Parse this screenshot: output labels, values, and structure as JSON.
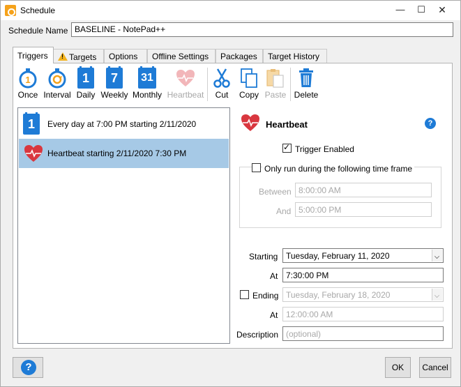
{
  "window": {
    "title": "Schedule",
    "minimize": "—",
    "maximize": "☐",
    "close": "✕"
  },
  "schedule_name": {
    "label": "Schedule Name",
    "value": "BASELINE - NotePad++"
  },
  "tabs": [
    {
      "label": "Triggers"
    },
    {
      "label": "Targets"
    },
    {
      "label": "Options"
    },
    {
      "label": "Offline Settings"
    },
    {
      "label": "Packages"
    },
    {
      "label": "Target History"
    }
  ],
  "toolbar": {
    "once": "Once",
    "interval": "Interval",
    "daily": "Daily",
    "daily_num": "1",
    "weekly": "Weekly",
    "weekly_num": "7",
    "monthly": "Monthly",
    "monthly_num": "31",
    "heartbeat": "Heartbeat",
    "cut": "Cut",
    "copy": "Copy",
    "paste": "Paste",
    "delete": "Delete"
  },
  "triggers": [
    {
      "text": "Every day at 7:00 PM starting 2/11/2020",
      "icon_num": "1"
    },
    {
      "text": "Heartbeat starting 2/11/2020 7:30 PM"
    }
  ],
  "detail": {
    "title": "Heartbeat",
    "help": "?",
    "trigger_enabled": "Trigger Enabled",
    "only_run_label": "Only run during the following time frame",
    "between_label": "Between",
    "between_value": "8:00:00 AM",
    "and_label": "And",
    "and_value": "5:00:00 PM",
    "starting_label": "Starting",
    "starting_value": "Tuesday, February 11, 2020",
    "start_at_label": "At",
    "start_at_value": "7:30:00 PM",
    "ending_label": "Ending",
    "ending_value": "Tuesday, February 18, 2020",
    "end_at_label": "At",
    "end_at_value": "12:00:00 AM",
    "description_label": "Description",
    "description_placeholder": "(optional)"
  },
  "footer": {
    "help": "?",
    "ok": "OK",
    "cancel": "Cancel"
  },
  "colors": {
    "accent_blue": "#1e7bd6",
    "selection": "#a6c9e6",
    "heart_red": "#d9373f",
    "warning": "#f3b31d"
  }
}
